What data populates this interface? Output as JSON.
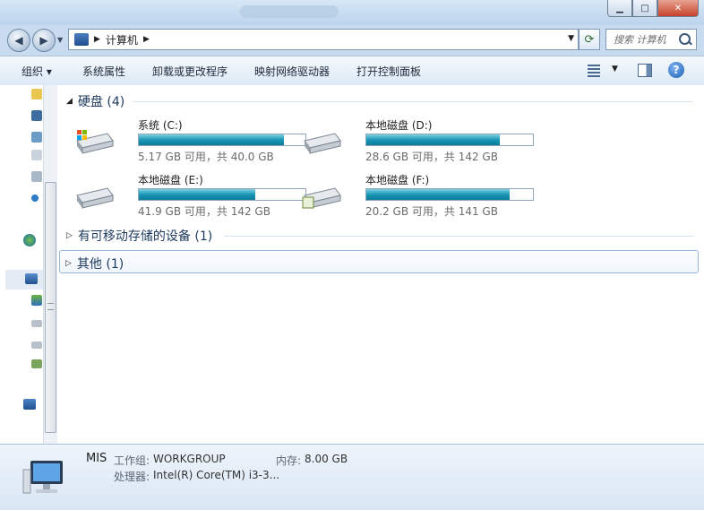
{
  "window": {
    "title": ""
  },
  "address": {
    "location": "计算机",
    "search_placeholder": "搜索 计算机"
  },
  "toolbar": {
    "organize": "组织 ▾",
    "system_properties": "系统属性",
    "uninstall": "卸载或更改程序",
    "map_drive": "映射网络驱动器",
    "control_panel": "打开控制面板"
  },
  "groups": {
    "hard_disks": {
      "label": "硬盘 (4)"
    },
    "removable": {
      "label": "有可移动存储的设备 (1)"
    },
    "other": {
      "label": "其他 (1)"
    }
  },
  "drives": [
    {
      "name": "系统 (C:)",
      "info": "5.17 GB 可用，共 40.0 GB",
      "used_fraction": 0.87
    },
    {
      "name": "本地磁盘 (D:)",
      "info": "28.6 GB 可用，共 142 GB",
      "used_fraction": 0.8
    },
    {
      "name": "本地磁盘 (E:)",
      "info": "41.9 GB 可用，共 142 GB",
      "used_fraction": 0.7
    },
    {
      "name": "本地磁盘 (F:)",
      "info": "20.2 GB 可用，共 141 GB",
      "used_fraction": 0.86
    }
  ],
  "details": {
    "computer_name": "MIS",
    "workgroup_label": "工作组:",
    "workgroup_value": "WORKGROUP",
    "memory_label": "内存:",
    "memory_value": "8.00 GB",
    "processor_label": "处理器:",
    "processor_value": "Intel(R) Core(TM) i3-3..."
  },
  "colors": {
    "bar_fill": "#1a97b6",
    "group_header": "#1e3a5f",
    "toolbar_bg": "#dde9f6"
  }
}
